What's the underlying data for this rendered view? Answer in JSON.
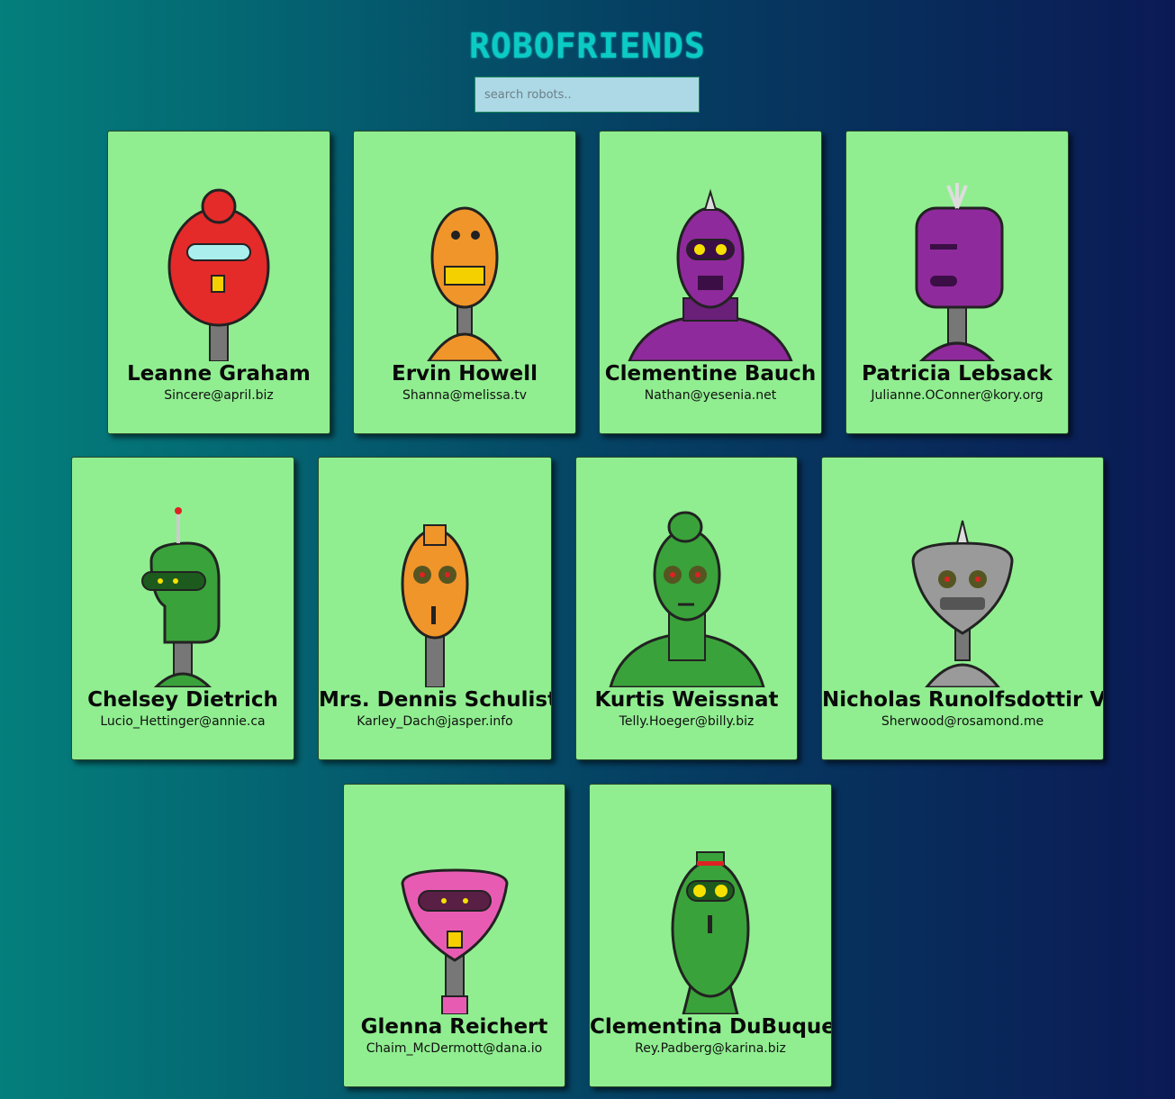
{
  "header": {
    "title": "ROBOFRIENDS"
  },
  "search": {
    "placeholder": "search robots.."
  },
  "robots": [
    {
      "name": "Leanne Graham",
      "email": "Sincere@april.biz",
      "color": "#e52a2a"
    },
    {
      "name": "Ervin Howell",
      "email": "Shanna@melissa.tv",
      "color": "#f0952a"
    },
    {
      "name": "Clementine Bauch",
      "email": "Nathan@yesenia.net",
      "color": "#8f2a9c"
    },
    {
      "name": "Patricia Lebsack",
      "email": "Julianne.OConner@kory.org",
      "color": "#8f2a9c"
    },
    {
      "name": "Chelsey Dietrich",
      "email": "Lucio_Hettinger@annie.ca",
      "color": "#3aa23a"
    },
    {
      "name": "Mrs. Dennis Schulist",
      "email": "Karley_Dach@jasper.info",
      "color": "#f0952a"
    },
    {
      "name": "Kurtis Weissnat",
      "email": "Telly.Hoeger@billy.biz",
      "color": "#3aa23a"
    },
    {
      "name": "Nicholas Runolfsdottir V",
      "email": "Sherwood@rosamond.me",
      "color": "#9a9a9a"
    },
    {
      "name": "Glenna Reichert",
      "email": "Chaim_McDermott@dana.io",
      "color": "#e85bb3"
    },
    {
      "name": "Clementina DuBuque",
      "email": "Rey.Padberg@karina.biz",
      "color": "#3aa23a"
    }
  ]
}
